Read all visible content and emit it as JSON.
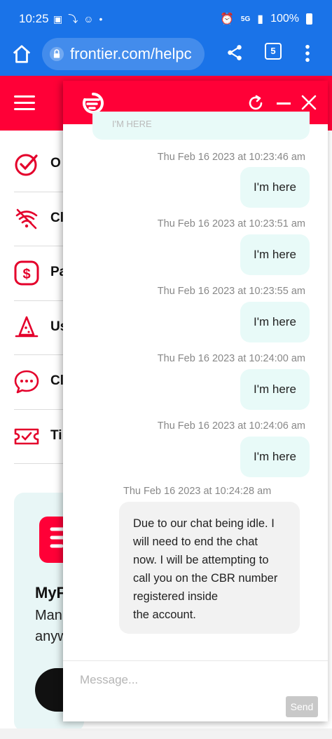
{
  "status_bar": {
    "time": "10:25",
    "network": "5G",
    "battery": "100%"
  },
  "browser": {
    "url": "frontier.com/helpc",
    "tab_count": "5"
  },
  "site_menu": {
    "items": [
      {
        "label": "O",
        "icon": "check-circle-icon"
      },
      {
        "label": "Cl",
        "icon": "wifi-off-icon"
      },
      {
        "label": "Pa",
        "icon": "dollar-icon"
      },
      {
        "label": "Us",
        "icon": "wizard-hat-icon"
      },
      {
        "label": "Cl",
        "icon": "chat-bubble-icon"
      },
      {
        "label": "Ti",
        "icon": "ticket-icon"
      }
    ]
  },
  "promo": {
    "title": "MyF",
    "subtitle_line1": "Man",
    "subtitle_line2": "anyw"
  },
  "chat": {
    "partial_text": "I'M HERE",
    "messages": [
      {
        "time": "Thu Feb 16 2023 at 10:23:46 am",
        "text": "I'm here"
      },
      {
        "time": "Thu Feb 16 2023 at 10:23:51 am",
        "text": "I'm here"
      },
      {
        "time": "Thu Feb 16 2023 at 10:23:55 am",
        "text": "I'm here"
      },
      {
        "time": "Thu Feb 16 2023 at 10:24:00 am",
        "text": "I'm here"
      },
      {
        "time": "Thu Feb 16 2023 at 10:24:06 am",
        "text": "I'm here"
      }
    ],
    "agent_message": {
      "time": "Thu Feb 16 2023 at 10:24:28 am",
      "lines": [
        "Due to our chat being idle. I",
        "will need to end the chat",
        "now. I will be attempting to",
        "call you on the CBR number",
        "registered inside",
        "the account."
      ]
    },
    "composer": {
      "placeholder": "Message...",
      "send_label": "Send"
    }
  },
  "colors": {
    "brand_red": "#ff0037",
    "chrome_blue": "#1a73e8",
    "user_bubble": "#e8faf8",
    "agent_bubble": "#f2f2f2"
  }
}
